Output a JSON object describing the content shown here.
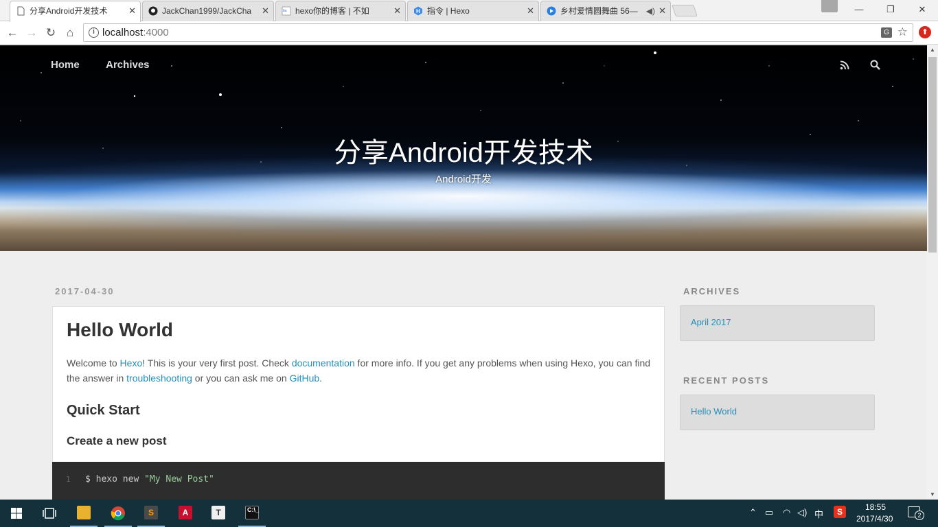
{
  "browser": {
    "tabs": [
      {
        "title": "分享Android开发技术",
        "favicon": "page-icon"
      },
      {
        "title": "JackChan1999/JackCha",
        "favicon": "github-icon"
      },
      {
        "title": "hexo你的博客 | 不如",
        "favicon": "baidu-icon"
      },
      {
        "title": "指令 | Hexo",
        "favicon": "hexo-icon"
      },
      {
        "title": "乡村爱情圆舞曲 56—",
        "favicon": "video-icon"
      }
    ],
    "url_host": "localhost",
    "url_port": ":4000"
  },
  "site": {
    "nav": [
      "Home",
      "Archives"
    ],
    "title": "分享Android开发技术",
    "subtitle": "Android开发"
  },
  "post": {
    "date": "2017-04-30",
    "title": "Hello World",
    "intro": {
      "t1": "Welcome to ",
      "link1": "Hexo",
      "t2": "! This is your very first post. Check ",
      "link2": "documentation",
      "t3": " for more info. If you get any problems when using Hexo, you can find the answer in ",
      "link3": "troubleshooting",
      "t4": " or you can ask me on ",
      "link4": "GitHub",
      "t5": "."
    },
    "h_quick": "Quick Start",
    "h_create": "Create a new post",
    "code": {
      "lineno": "1",
      "cmd": "$ hexo new ",
      "arg": "\"My New Post\""
    }
  },
  "sidebar": {
    "archives_title": "ARCHIVES",
    "archives_item": "April 2017",
    "recent_title": "RECENT POSTS",
    "recent_item": "Hello World"
  },
  "taskbar": {
    "apps": [
      "start-icon",
      "task-view-icon",
      "file-explorer-icon",
      "chrome-icon",
      "sublime-icon",
      "acrobat-icon",
      "typora-icon",
      "terminal-icon"
    ],
    "ime": "中",
    "time": "18:55",
    "date": "2017/4/30",
    "notifications": "2"
  },
  "colors": {
    "link": "#258fb8",
    "taskbar": "#14303a",
    "code_bg": "#2d2d2d"
  }
}
